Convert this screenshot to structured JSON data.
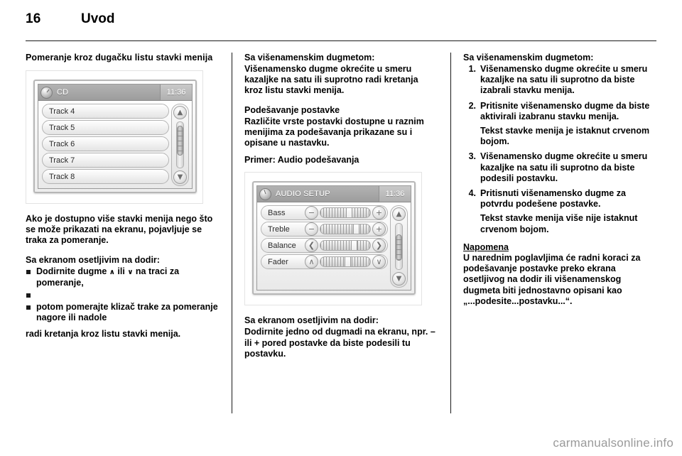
{
  "page": {
    "folio": "16",
    "chapter": "Uvod",
    "watermark": "carmanualsonline.info"
  },
  "column_left": {
    "heading": "Pomeranje kroz dugačku listu stavki menija",
    "figure": {
      "name": "cd-track-list-screen",
      "titlebar": {
        "icon": "cd-disc-icon",
        "title": "CD",
        "clock": "11:36"
      },
      "rows": [
        {
          "label": "Track 4"
        },
        {
          "label": "Track 5"
        },
        {
          "label": "Track 6"
        },
        {
          "label": "Track 7"
        },
        {
          "label": "Track 8"
        }
      ],
      "scrollbar": {
        "up_arrow": "chevron-up-icon",
        "down_arrow": "chevron-down-icon",
        "up_glyph": "▲",
        "down_glyph": "▼"
      }
    },
    "para_1": "Ako je dostupno više stavki menija nego što se može prikazati na ekranu, pojavljuje se traka za pomeranje.",
    "subhead_touch": "Sa ekranom osetljivim na dodir:",
    "bullet_1": "Dodirnite dugme",
    "bullet_1_arrow_up": "∧",
    "bullet_1_mid": "ili",
    "bullet_1_arrow_down": "∨",
    "bullet_1_end": "na traci za pomeranje,",
    "bullet_2": "",
    "bullet_3": "potom pomerajte klizač trake za pomeranje nagore ili nadole",
    "para_2": "radi kretanja kroz listu stavki menija."
  },
  "column_middle": {
    "subhead_multifunction": "Sa višenamenskim dugmetom:",
    "para_1": "Višenamensko dugme okrećite u smeru kazaljke na satu ili suprotno radi kretanja kroz listu stavki menija.",
    "subhead_setting": "Podešavanje postavke",
    "para_2": "Različite vrste postavki dostupne u raznim menijima za podešavanja prikazane su i opisane u nastavku.",
    "example_label": "Primer: Audio podešavanja",
    "figure": {
      "name": "audio-setup-screen",
      "titlebar": {
        "icon": "note-disc-icon",
        "title": "AUDIO SETUP",
        "clock": "11:36"
      },
      "rows": [
        {
          "label": "Bass",
          "left_btn": "minus-button",
          "left_glyph": "−",
          "right_btn": "plus-button",
          "right_glyph": "+",
          "knob_pct": 52
        },
        {
          "label": "Treble",
          "left_btn": "minus-button",
          "left_glyph": "−",
          "right_btn": "plus-button",
          "right_glyph": "+",
          "knob_pct": 66
        },
        {
          "label": "Balance",
          "left_btn": "left-arrow-button",
          "left_glyph": "❮",
          "right_btn": "right-arrow-button",
          "right_glyph": "❯",
          "knob_pct": 62
        },
        {
          "label": "Fader",
          "left_btn": "up-arrow-button",
          "left_glyph": "∧",
          "right_btn": "down-arrow-button",
          "right_glyph": "∨",
          "knob_pct": 48
        }
      ],
      "scrollbar": {
        "up_arrow": "chevron-up-icon",
        "down_arrow": "chevron-down-icon",
        "up_glyph": "▲",
        "down_glyph": "▼"
      }
    },
    "subhead_touch": "Sa ekranom osetljivim na dodir:",
    "para_3": "Dodirnite jedno od dugmadi na ekranu, npr. – ili + pored postavke da biste podesili tu postavku."
  },
  "column_right": {
    "subhead_multifunction": "Sa višenamenskim dugmetom:",
    "steps": [
      {
        "num": "1.",
        "text": "Višenamensko dugme okrećite u smeru kazaljke na satu ili suprotno da biste izabrali stavku menija."
      },
      {
        "num": "2.",
        "text": "Pritisnite višenamensko dugme da biste aktivirali izabranu stavku menija."
      },
      {
        "num": "3.",
        "text": "Višenamensko dugme okrećite u smeru kazaljke na satu ili suprotno da biste podesili postavku."
      },
      {
        "num": "4.",
        "text": "Pritisnuti višenamensko dugme za potvrdu podešene postavke."
      }
    ],
    "after_step_2": "Tekst stavke menija je istaknut crvenom bojom.",
    "after_step_4": "Tekst stavke menija više nije istaknut crvenom bojom.",
    "note_label": "Napomena",
    "note_text": "U narednim poglavljima će radni koraci za podešavanje postavke preko ekrana osetljivog na dodir ili višenamenskog dugmeta biti jednostavno opisani kao „...podesite...postavku...“."
  }
}
